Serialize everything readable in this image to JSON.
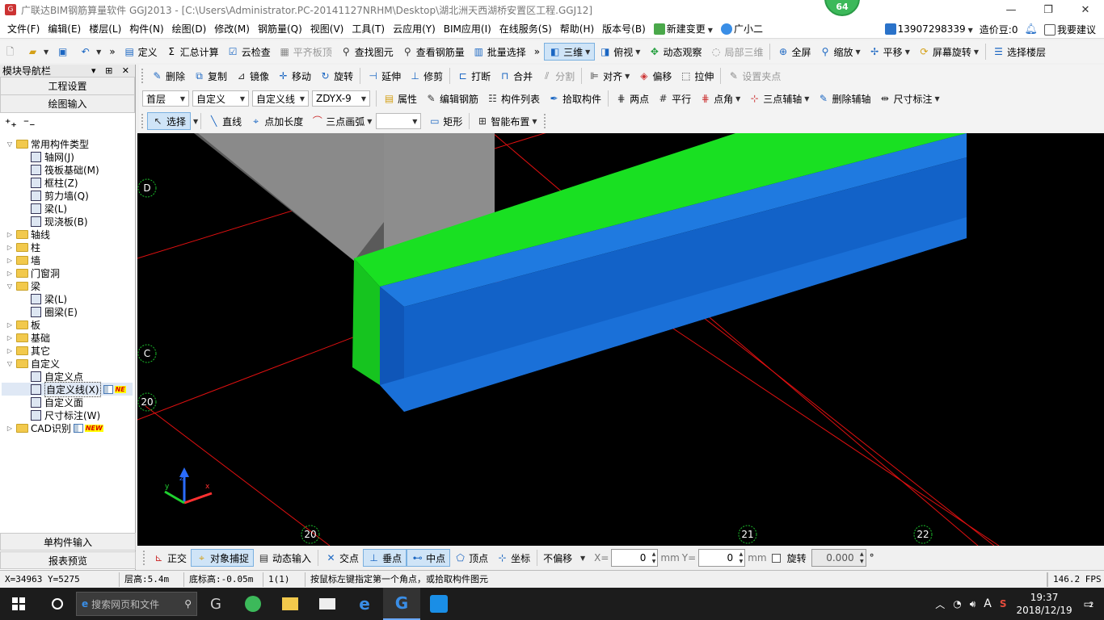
{
  "window": {
    "title": "广联达BIM钢筋算量软件 GGJ2013 - [C:\\Users\\Administrator.PC-20141127NRHM\\Desktop\\湖北洲天西湖桥安置区工程.GGJ12]",
    "badge": "64"
  },
  "menu": {
    "items": [
      "文件(F)",
      "编辑(E)",
      "楼层(L)",
      "构件(N)",
      "绘图(D)",
      "修改(M)",
      "钢筋量(Q)",
      "视图(V)",
      "工具(T)",
      "云应用(Y)",
      "BIM应用(I)",
      "在线服务(S)",
      "帮助(H)",
      "版本号(B)"
    ],
    "new_change": "新建变更",
    "assistant": "广小二",
    "phone": "13907298339",
    "price_beans": "造价豆:0",
    "feedback": "我要建议"
  },
  "toolbar1": {
    "define": "定义",
    "sum": "汇总计算",
    "cloud_check": "云检查",
    "align_top": "平齐板顶",
    "find": "查找图元",
    "view_rebar": "查看钢筋量",
    "batch_select": "批量选择",
    "view3d": "三维",
    "top_view": "俯视",
    "dynamic": "动态观察",
    "local3d": "局部三维",
    "fullscreen": "全屏",
    "zoom": "缩放",
    "pan": "平移",
    "rotate_screen": "屏幕旋转",
    "select_floor": "选择楼层"
  },
  "toolbar2": {
    "delete": "删除",
    "copy": "复制",
    "mirror": "镜像",
    "move": "移动",
    "rotate": "旋转",
    "extend": "延伸",
    "trim": "修剪",
    "break": "打断",
    "merge": "合并",
    "split": "分割",
    "align": "对齐",
    "offset": "偏移",
    "stretch": "拉伸",
    "set_grip": "设置夹点"
  },
  "toolbar3": {
    "floor": "首层",
    "category": "自定义",
    "type": "自定义线",
    "component": "ZDYX-9",
    "property": "属性",
    "edit_rebar": "编辑钢筋",
    "comp_list": "构件列表",
    "pick": "拾取构件",
    "two_point": "两点",
    "parallel": "平行",
    "point_angle": "点角",
    "three_point_aux": "三点辅轴",
    "delete_aux": "删除辅轴",
    "dimension": "尺寸标注"
  },
  "toolbar4": {
    "select": "选择",
    "line": "直线",
    "point_length": "点加长度",
    "arc3": "三点画弧",
    "rect": "矩形",
    "smart": "智能布置"
  },
  "nav": {
    "title": "模块导航栏",
    "controls": "▾ ⊞ ✕",
    "tab_project": "工程设置",
    "tab_draw": "绘图输入",
    "bottom_single": "单构件输入",
    "bottom_report": "报表预览",
    "tree": [
      {
        "label": "常用构件类型",
        "level": 0,
        "kind": "folder",
        "expanded": true
      },
      {
        "label": "轴网(J)",
        "level": 1,
        "kind": "leaf"
      },
      {
        "label": "筏板基础(M)",
        "level": 1,
        "kind": "leaf"
      },
      {
        "label": "框柱(Z)",
        "level": 1,
        "kind": "leaf"
      },
      {
        "label": "剪力墙(Q)",
        "level": 1,
        "kind": "leaf"
      },
      {
        "label": "梁(L)",
        "level": 1,
        "kind": "leaf"
      },
      {
        "label": "现浇板(B)",
        "level": 1,
        "kind": "leaf"
      },
      {
        "label": "轴线",
        "level": 0,
        "kind": "folder",
        "expanded": false
      },
      {
        "label": "柱",
        "level": 0,
        "kind": "folder",
        "expanded": false
      },
      {
        "label": "墙",
        "level": 0,
        "kind": "folder",
        "expanded": false
      },
      {
        "label": "门窗洞",
        "level": 0,
        "kind": "folder",
        "expanded": false
      },
      {
        "label": "梁",
        "level": 0,
        "kind": "folder",
        "expanded": true
      },
      {
        "label": "梁(L)",
        "level": 1,
        "kind": "leaf"
      },
      {
        "label": "圈梁(E)",
        "level": 1,
        "kind": "leaf"
      },
      {
        "label": "板",
        "level": 0,
        "kind": "folder",
        "expanded": false
      },
      {
        "label": "基础",
        "level": 0,
        "kind": "folder",
        "expanded": false
      },
      {
        "label": "其它",
        "level": 0,
        "kind": "folder",
        "expanded": false
      },
      {
        "label": "自定义",
        "level": 0,
        "kind": "folder",
        "expanded": true
      },
      {
        "label": "自定义点",
        "level": 1,
        "kind": "leaf"
      },
      {
        "label": "自定义线(X)",
        "level": 1,
        "kind": "leaf",
        "selected": true,
        "tag": "NE"
      },
      {
        "label": "自定义面",
        "level": 1,
        "kind": "leaf"
      },
      {
        "label": "尺寸标注(W)",
        "level": 1,
        "kind": "leaf"
      },
      {
        "label": "CAD识别",
        "level": 0,
        "kind": "folder",
        "expanded": false,
        "tag": "NEW"
      }
    ]
  },
  "viewport": {
    "axis_labels": {
      "d": "D",
      "c": "C",
      "a20_left": "20",
      "a20_bottom": "20",
      "a21": "21",
      "a22": "22"
    },
    "colors": {
      "green": "#19e022",
      "blue": "#1262c8",
      "gray": "#8a8a8a",
      "axis": "#e01010"
    }
  },
  "snapbar": {
    "ortho": "正交",
    "obj_snap": "对象捕捉",
    "dyn_input": "动态输入",
    "intersect": "交点",
    "perp": "垂点",
    "mid": "中点",
    "vertex": "顶点",
    "coord": "坐标",
    "offset_mode": "不偏移",
    "x_label": "X=",
    "x_value": "0",
    "y_label": "Y=",
    "y_value": "0",
    "unit": "mm",
    "rotate": "旋转",
    "rotate_value": "0.000",
    "degree": "°"
  },
  "status": {
    "coords": "X=34963 Y=5275",
    "floor_height": "层高:5.4m",
    "bottom_elev": "底标高:-0.05m",
    "count": "1(1)",
    "hint": "按鼠标左键指定第一个角点，或拾取构件图元",
    "fps": "146.2 FPS"
  },
  "taskbar": {
    "search": "搜索网页和文件",
    "time": "19:37",
    "date": "2018/12/19",
    "notif": "2",
    "ime": "A"
  }
}
